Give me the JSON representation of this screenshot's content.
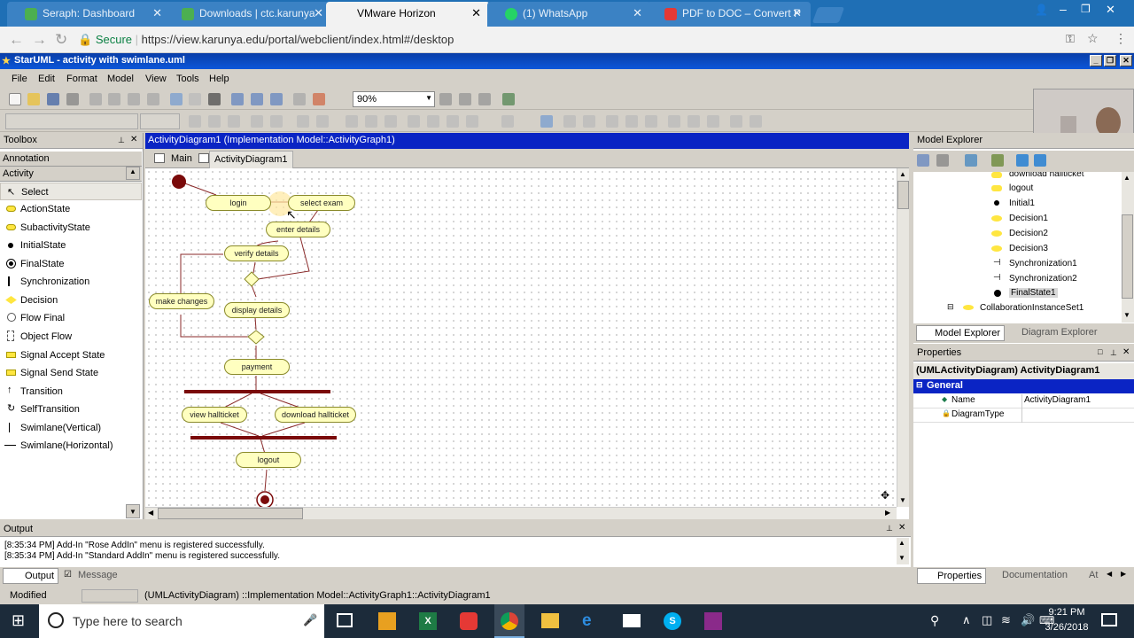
{
  "browser": {
    "tabs": [
      {
        "label": "Seraph: Dashboard",
        "color": "#4caf50"
      },
      {
        "label": "Downloads | ctc.karunya",
        "color": "#4caf50"
      },
      {
        "label": "VMware Horizon",
        "color": "#1aa1e2"
      },
      {
        "label": "(1) WhatsApp",
        "color": "#25d366"
      },
      {
        "label": "PDF to DOC – Convert P",
        "color": "#e53935"
      }
    ],
    "secure_label": "Secure",
    "url": "https://view.karunya.edu/portal/webclient/index.html#/desktop"
  },
  "app": {
    "title": "StarUML - activity with swimlane.uml",
    "menus": [
      "File",
      "Edit",
      "Format",
      "Model",
      "View",
      "Tools",
      "Help"
    ],
    "zoom": "90%"
  },
  "toolbox": {
    "title": "Toolbox",
    "section_annotation": "Annotation",
    "section_activity": "Activity",
    "items": [
      {
        "label": "Select",
        "icon": "arrow-cursor-icon"
      },
      {
        "label": "ActionState",
        "icon": "action-state-icon"
      },
      {
        "label": "SubactivityState",
        "icon": "subactivity-icon"
      },
      {
        "label": "InitialState",
        "icon": "initial-state-icon"
      },
      {
        "label": "FinalState",
        "icon": "final-state-icon"
      },
      {
        "label": "Synchronization",
        "icon": "sync-icon"
      },
      {
        "label": "Decision",
        "icon": "decision-icon"
      },
      {
        "label": "Flow Final",
        "icon": "flow-final-icon"
      },
      {
        "label": "Object Flow",
        "icon": "object-flow-icon"
      },
      {
        "label": "Signal Accept State",
        "icon": "signal-accept-icon"
      },
      {
        "label": "Signal Send State",
        "icon": "signal-send-icon"
      },
      {
        "label": "Transition",
        "icon": "transition-icon"
      },
      {
        "label": "SelfTransition",
        "icon": "self-transition-icon"
      },
      {
        "label": "Swimlane(Vertical)",
        "icon": "swimlane-vertical-icon"
      },
      {
        "label": "Swimlane(Horizontal)",
        "icon": "swimlane-horizontal-icon"
      }
    ]
  },
  "diagram": {
    "title": "ActivityDiagram1 (Implementation Model::ActivityGraph1)",
    "tabs": [
      "Main",
      "ActivityDiagram1"
    ],
    "nodes": {
      "login": "login",
      "select_exam": "select exam",
      "enter_details": "enter details",
      "verify_details": "verify details",
      "make_changes": "make changes",
      "display_details": "display details",
      "payment": "payment",
      "view_hallticket": "view hallticket",
      "download_hallticket": "download hallticket",
      "logout": "logout"
    }
  },
  "model_explorer": {
    "title": "Model Explorer",
    "items": [
      "download hallticket",
      "logout",
      "Initial1",
      "Decision1",
      "Decision2",
      "Decision3",
      "Synchronization1",
      "Synchronization2",
      "FinalState1"
    ],
    "parent_item": "CollaborationInstanceSet1",
    "tabs": [
      "Model Explorer",
      "Diagram Explorer"
    ]
  },
  "properties": {
    "title": "Properties",
    "header": "(UMLActivityDiagram) ActivityDiagram1",
    "section": "General",
    "rows": [
      {
        "name": "Name",
        "value": "ActivityDiagram1"
      },
      {
        "name": "DiagramType",
        "value": ""
      }
    ],
    "tabs": [
      "Properties",
      "Documentation",
      "At"
    ]
  },
  "output": {
    "title": "Output",
    "lines": [
      "[8:35:34 PM]  Add-In \"Rose AddIn\" menu is registered successfully.",
      "[8:35:34 PM]  Add-In \"Standard AddIn\" menu is registered successfully."
    ],
    "tabs": [
      "Output",
      "Message"
    ]
  },
  "status": {
    "mode": "Modified",
    "path": "(UMLActivityDiagram) ::Implementation Model::ActivityGraph1::ActivityDiagram1"
  },
  "taskbar": {
    "search_placeholder": "Type here to search",
    "time": "9:21 PM",
    "date": "3/26/2018"
  }
}
